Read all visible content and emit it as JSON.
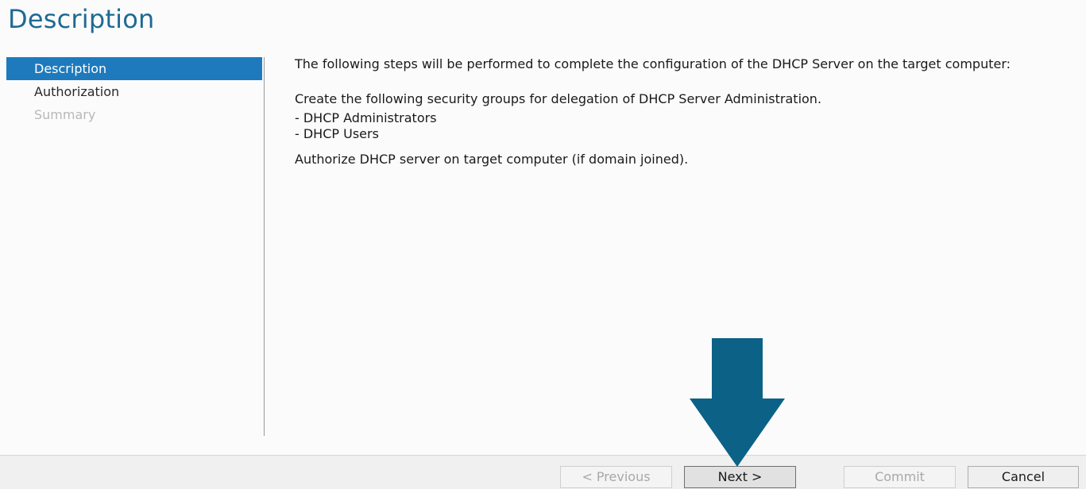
{
  "page": {
    "title": "Description"
  },
  "nav": {
    "items": [
      {
        "label": "Description",
        "state": "active"
      },
      {
        "label": "Authorization",
        "state": "normal"
      },
      {
        "label": "Summary",
        "state": "disabled"
      }
    ]
  },
  "content": {
    "intro": "The following steps will be performed to complete the configuration of the DHCP Server on the target computer:",
    "groups_heading": "Create the following security groups for delegation of DHCP Server Administration.",
    "groups": [
      "- DHCP Administrators",
      "- DHCP Users"
    ],
    "authorize": "Authorize DHCP server on target computer (if domain joined)."
  },
  "footer": {
    "previous_label": "< Previous",
    "next_label": "Next >",
    "commit_label": "Commit",
    "cancel_label": "Cancel"
  },
  "annotation": {
    "icon": "down-arrow-icon",
    "color": "#0c6186"
  },
  "colors": {
    "accent": "#1e7abd",
    "title": "#1e6a93"
  }
}
